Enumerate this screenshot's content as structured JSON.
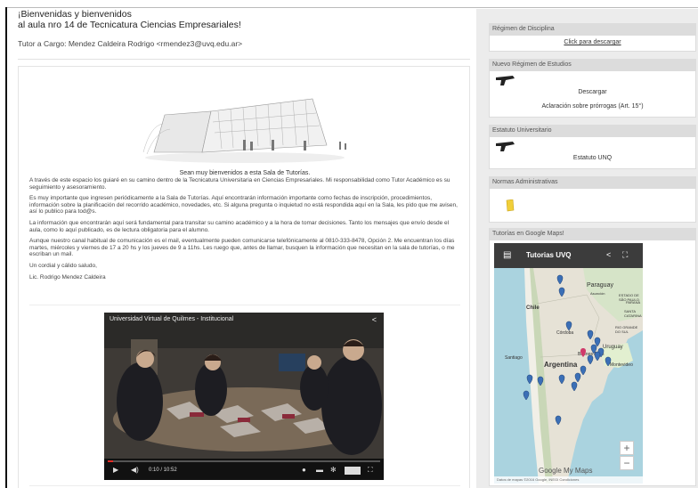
{
  "main": {
    "title_line1": "¡Bienvenidas y bienvenidos",
    "title_line2": "al aula nro 14 de Tecnicatura Ciencias Empresariales!",
    "tutor_line": "Tutor a Cargo: Mendez Caldeira Rodrigo <rmendez3@uvq.edu.ar>",
    "welcome_center": "Sean muy bienvenidos a esta Sala de Tutorías.",
    "paragraphs": [
      "A través de este espacio los guiaré en su camino dentro de la Tecnicatura Universitaria en Ciencias Empresariales. Mi responsabilidad como Tutor Académico es su seguimiento y asesoramiento.",
      "Es muy importante que ingresen periódicamente a la Sala de Tutorías. Aquí encontrarán información importante como fechas de inscripción, procedimientos, información sobre la planificación del recorrido académico, novedades, etc. Si alguna pregunta o inquietud no está respondida aquí en la Sala, les pido que me avisen, así lo publico para tod@s.",
      "La información que encontrarán aquí será fundamental para transitar su camino académico y a la hora de tomar decisiones. Tanto los mensajes que envío desde el aula, como lo aquí publicado, es de lectura obligatoria para el alumno.",
      "Aunque nuestro canal habitual de comunicación es el mail, eventualmente pueden comunicarse telefónicamente al 0810-333-8478, Opción 2. Me encuentran los días martes, miércoles y viernes de 17 a 20 hs y los jueves de 9 a 11hs. Les ruego que, antes de llamar, busquen la información que necesitan en la sala de tutorías, o me escriban un mail.",
      "Un cordial y cálido saludo,",
      "Lic. Rodrigo Mendez Caldeira"
    ],
    "video": {
      "title": "Universidad Virtual de Quilmes - Institucional",
      "time": "0:10 / 10:52",
      "progress": 0.02
    }
  },
  "sidebar": {
    "panels": [
      {
        "header": "Régimen de Disciplina",
        "link": "Click para descargar"
      },
      {
        "header": "Nuevo Régimen de Estudios",
        "line1": "Descargar",
        "line2": "Aclaración sobre prórrogas (Art. 15°)"
      },
      {
        "header": "Estatuto Universitario",
        "line1": "Estatuto UNQ"
      },
      {
        "header": "Normas Administrativas"
      },
      {
        "header": "Tutorías en Google Maps!"
      }
    ],
    "map": {
      "title": "Tutorias UVQ",
      "labels": [
        "Paraguay",
        "Asunción",
        "ESTADO DE SÃO PAULO",
        "Chile",
        "Córdoba",
        "Uruguay",
        "Buenos Aires",
        "Montevideo",
        "Santiago",
        "Argentina",
        "RIO GRANDE DO SUL",
        "PARANÁ",
        "SANTA CATARINA"
      ],
      "brand": "Google My Maps",
      "footer": "Datos de mapas ©2016 Google, INEGI   Condiciones"
    }
  }
}
